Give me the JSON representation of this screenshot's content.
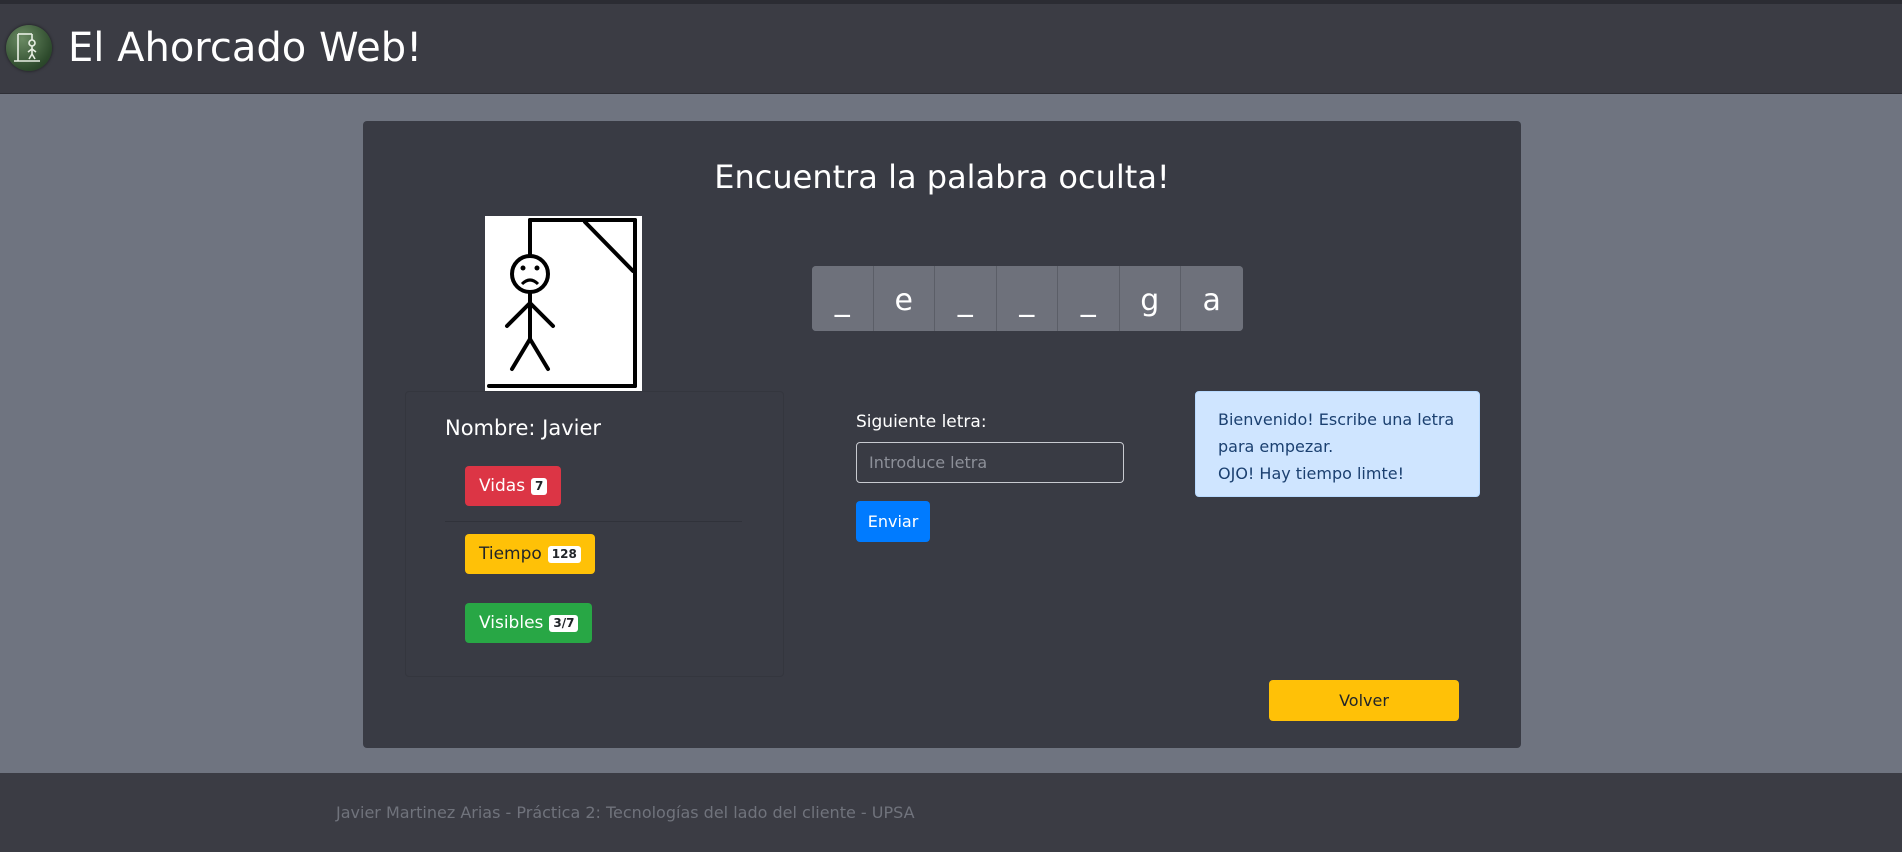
{
  "header": {
    "title": "El Ahorcado Web!",
    "logo_icon": "hangman-logo-icon"
  },
  "game": {
    "title": "Encuentra la palabra oculta!",
    "hangman_image": "hangman-sad-figure",
    "word_letters": [
      "_",
      "e",
      "_",
      "_",
      "_",
      "g",
      "a"
    ]
  },
  "player": {
    "name_label": "Nombre: Javier",
    "stats": {
      "vidas_label": "Vidas",
      "vidas_value": "7",
      "tiempo_label": "Tiempo",
      "tiempo_value": "128",
      "visibles_label": "Visibles",
      "visibles_value": "3/7"
    }
  },
  "form": {
    "label": "Siguiente letra:",
    "placeholder": "Introduce letra",
    "value": "",
    "submit_label": "Enviar"
  },
  "alert": {
    "line1": "Bienvenido! Escribe una letra para empezar.",
    "line2": "OJO! Hay tiempo limte!"
  },
  "actions": {
    "back_label": "Volver"
  },
  "footer": {
    "text": "Javier Martinez Arias - Práctica 2: Tecnologías del lado del cliente - UPSA"
  },
  "colors": {
    "danger": "#dc3545",
    "warning": "#ffc107",
    "success": "#28a745",
    "primary": "#007bff",
    "info_bg": "#cfe5ff"
  }
}
